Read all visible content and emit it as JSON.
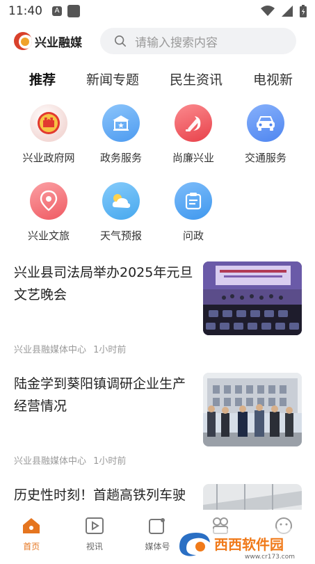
{
  "status_bar": {
    "time": "11:40",
    "a_label": "A"
  },
  "header": {
    "logo_text": "兴业融媒",
    "search_placeholder": "请输入搜索内容"
  },
  "tabs": [
    {
      "label": "推荐"
    },
    {
      "label": "新闻专题"
    },
    {
      "label": "民生资讯"
    },
    {
      "label": "电视新"
    }
  ],
  "shortcuts": [
    {
      "label": "兴业政府网",
      "icon": "national-emblem-icon",
      "color": "#e04a3f"
    },
    {
      "label": "政务服务",
      "icon": "government-building-icon",
      "color": "#4d9bf0"
    },
    {
      "label": "尚廉兴业",
      "icon": "party-emblem-icon",
      "color": "#e8414a"
    },
    {
      "label": "交通服务",
      "icon": "car-icon",
      "color": "#4f86f0"
    },
    {
      "label": "兴业文旅",
      "icon": "location-pin-icon",
      "color": "#ef5a62"
    },
    {
      "label": "天气预报",
      "icon": "weather-icon",
      "color": "#47a8ee"
    },
    {
      "label": "问政",
      "icon": "consult-icon",
      "color": "#3f98ee"
    }
  ],
  "news": [
    {
      "title": "兴业县司法局举办2025年元旦文艺晚会",
      "source": "兴业县融媒体中心",
      "time": "1小时前"
    },
    {
      "title": "陆金学到葵阳镇调研企业生产经营情况",
      "source": "兴业县融媒体中心",
      "time": "1小时前"
    },
    {
      "title": "历史性时刻！首趟高铁列车驶入兴业车站",
      "source": "",
      "time": ""
    }
  ],
  "bottom_nav": [
    {
      "label": "首页",
      "active": true
    },
    {
      "label": "视讯"
    },
    {
      "label": "媒体号"
    },
    {
      "label": ""
    },
    {
      "label": ""
    }
  ],
  "watermark": {
    "text": "西西软件园",
    "url": "www.cr173.com"
  },
  "colors": {
    "accent": "#e5751f"
  }
}
